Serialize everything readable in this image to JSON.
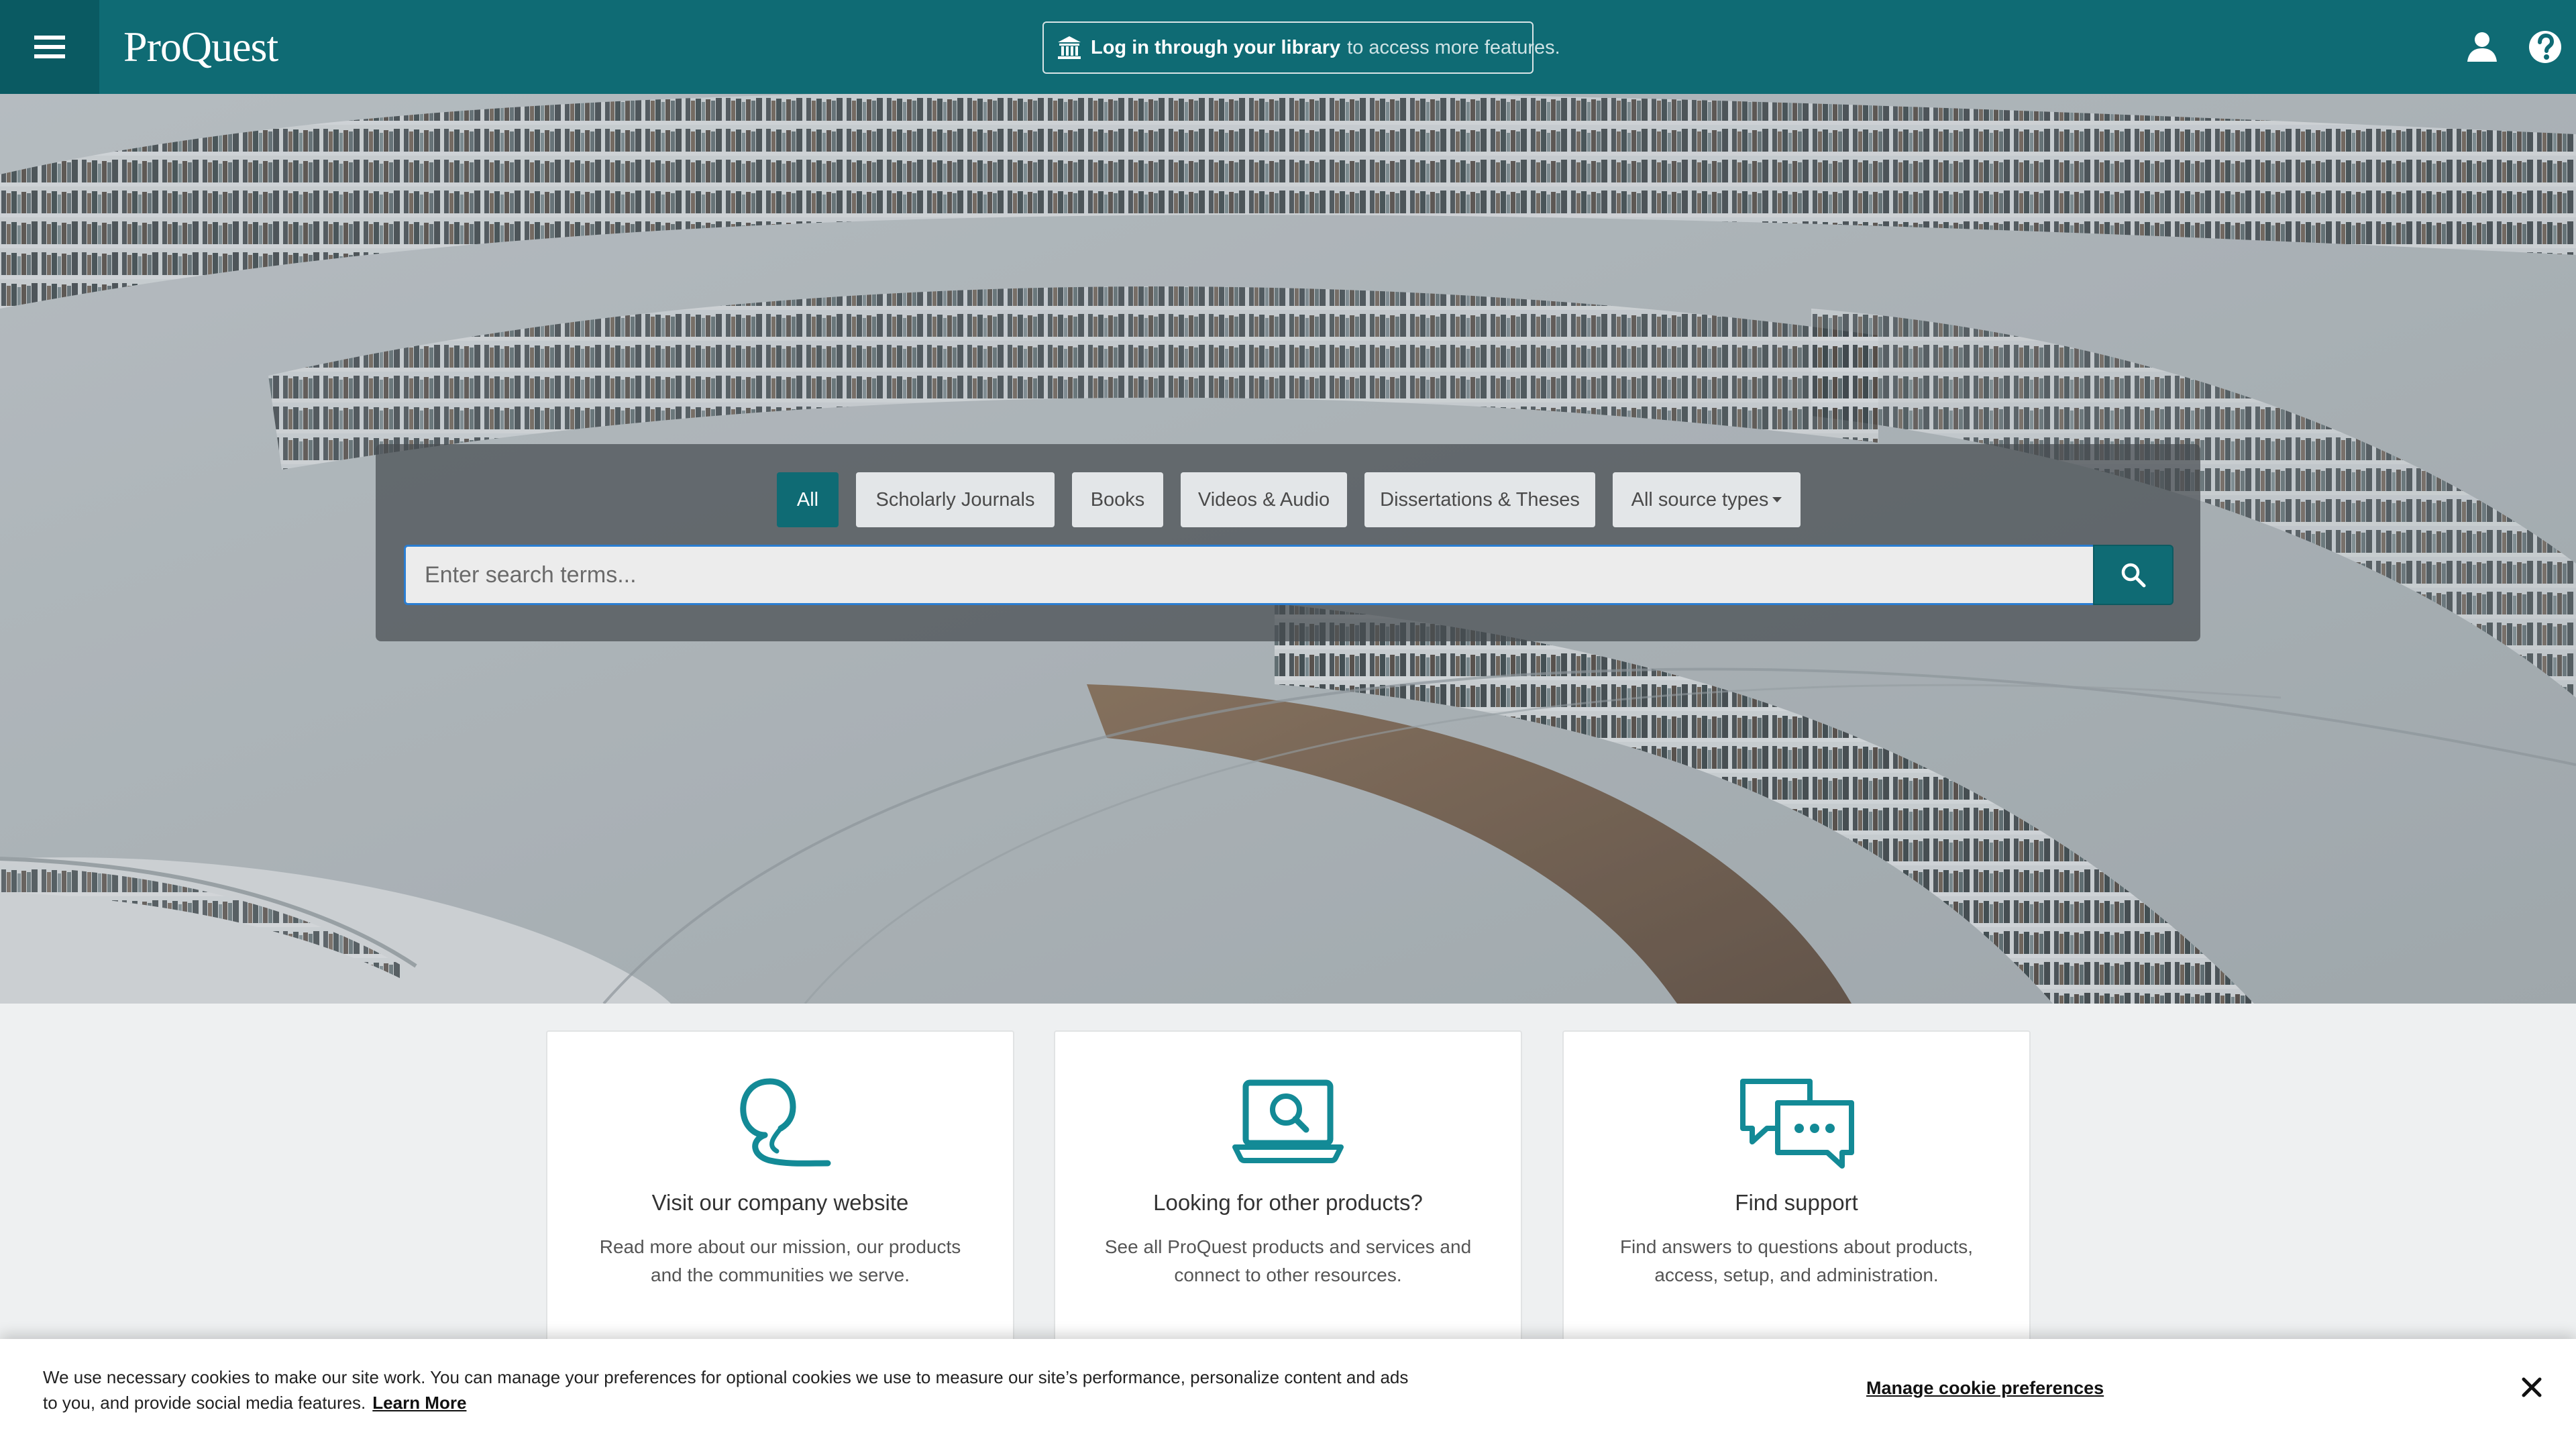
{
  "header": {
    "logo": "ProQuest",
    "login_strong": "Log in through your library",
    "login_rest": "to access more features.",
    "icons": {
      "menu": "hamburger-menu-icon",
      "library": "institution-icon",
      "user": "user-icon",
      "help": "help-icon"
    }
  },
  "search": {
    "tabs": [
      {
        "label": "All",
        "active": true
      },
      {
        "label": "Scholarly Journals",
        "active": false
      },
      {
        "label": "Books",
        "active": false
      },
      {
        "label": "Videos & Audio",
        "active": false
      },
      {
        "label": "Dissertations & Theses",
        "active": false
      },
      {
        "label": "All source types",
        "active": false
      }
    ],
    "placeholder": "Enter search terms...",
    "button_icon": "search-icon"
  },
  "cards": [
    {
      "title": "Visit our company website",
      "description": "Read more about our mission, our products and the communities we serve.",
      "icon": "proquest-q-icon"
    },
    {
      "title": "Looking for other products?",
      "description": "See all ProQuest products and services and connect to other resources.",
      "icon": "laptop-search-icon"
    },
    {
      "title": "Find support",
      "description": "Find answers to questions about products, access, setup, and administration.",
      "icon": "chat-bubbles-icon"
    }
  ],
  "cookie": {
    "text": "We use necessary cookies to make our site work. You can manage your preferences for optional cookies we use to measure our site’s performance, personalize content and ads to you, and provide social media features.",
    "learn_more": "Learn More",
    "manage": "Manage cookie preferences"
  },
  "colors": {
    "brand_teal": "#0f6b74",
    "brand_teal_dark": "#0a5a62",
    "icon_teal": "#138a96"
  }
}
